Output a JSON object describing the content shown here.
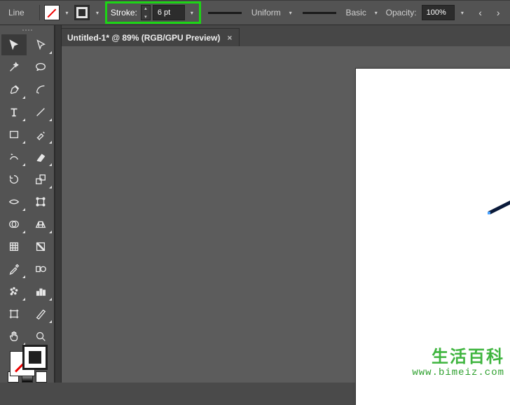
{
  "topbar": {
    "tool_label": "Line",
    "stroke_label": "Stroke:",
    "stroke_value": "6 pt",
    "width_profile": "Uniform",
    "brush_def": "Basic",
    "opacity_label": "Opacity:",
    "opacity_value": "100%"
  },
  "tab": {
    "title": "Untitled-1* @ 89% (RGB/GPU Preview)",
    "close": "×"
  },
  "tools": {
    "names": [
      "selection-tool",
      "direct-selection-tool",
      "magic-wand-tool",
      "lasso-tool",
      "pen-tool",
      "curvature-tool",
      "type-tool",
      "line-segment-tool",
      "rectangle-tool",
      "paintbrush-tool",
      "shaper-tool",
      "eraser-tool",
      "rotate-tool",
      "scale-tool",
      "width-tool",
      "free-transform-tool",
      "shape-builder-tool",
      "perspective-grid-tool",
      "mesh-tool",
      "gradient-tool",
      "eyedropper-tool",
      "blend-tool",
      "symbol-sprayer-tool",
      "column-graph-tool",
      "artboard-tool",
      "slice-tool",
      "hand-tool",
      "zoom-tool"
    ]
  },
  "watermark": {
    "text": "生活百科",
    "url": "www.bimeiz.com"
  }
}
